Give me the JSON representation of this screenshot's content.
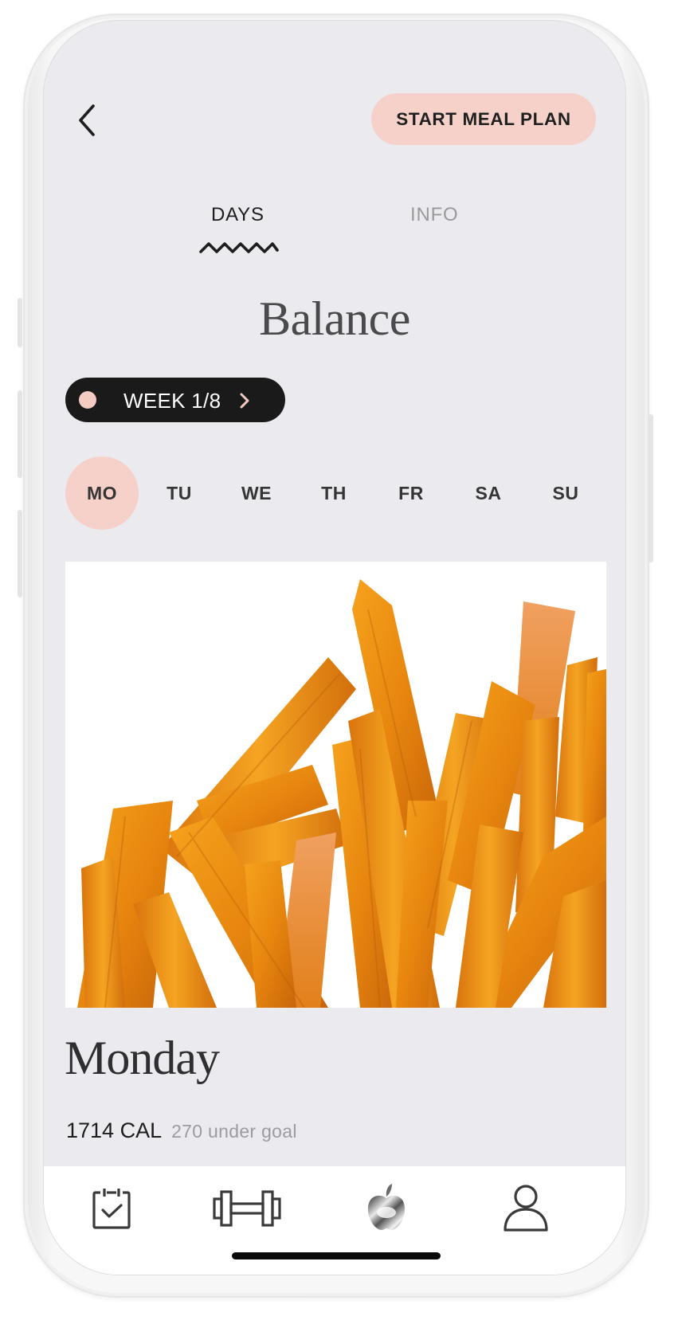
{
  "header": {
    "back_icon": "chevron-left-icon",
    "cta_label": "START MEAL PLAN"
  },
  "tabs": [
    {
      "label": "DAYS",
      "active": true
    },
    {
      "label": "INFO",
      "active": false
    }
  ],
  "plan": {
    "title": "Balance",
    "week_label": "WEEK 1/8",
    "week_icon": "chevron-right-icon"
  },
  "days": [
    {
      "label": "MO",
      "selected": true
    },
    {
      "label": "TU",
      "selected": false
    },
    {
      "label": "WE",
      "selected": false
    },
    {
      "label": "TH",
      "selected": false
    },
    {
      "label": "FR",
      "selected": false
    },
    {
      "label": "SA",
      "selected": false
    },
    {
      "label": "SU",
      "selected": false
    }
  ],
  "meal": {
    "image_subject": "sweet potato fries",
    "day_name": "Monday",
    "calories": "1714 CAL",
    "goal_note": "270 under goal"
  },
  "bottom_nav": [
    {
      "name": "planner",
      "icon": "calendar-check-icon"
    },
    {
      "name": "workouts",
      "icon": "dumbbell-icon"
    },
    {
      "name": "nutrition",
      "icon": "apple-icon",
      "active": true
    },
    {
      "name": "profile",
      "icon": "person-icon"
    }
  ],
  "colors": {
    "accent_pink": "#f5d1c9",
    "screen_bg": "#ebeaee",
    "pill_dark": "#1a1a1a",
    "muted_text": "#9c9ca0"
  }
}
